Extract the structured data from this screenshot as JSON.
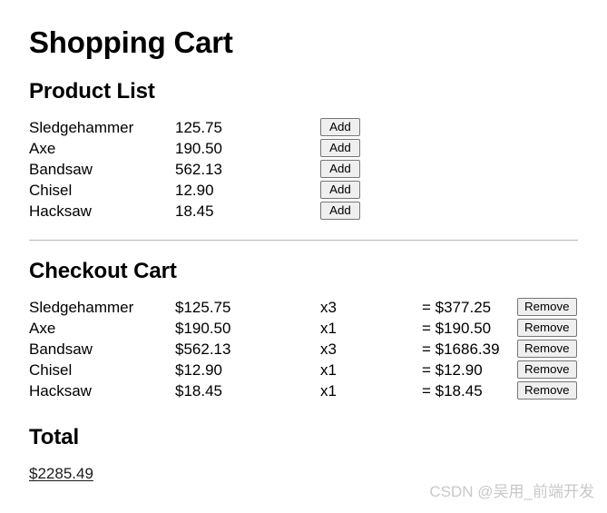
{
  "page": {
    "title": "Shopping Cart"
  },
  "product_list": {
    "heading": "Product List",
    "add_label": "Add",
    "items": [
      {
        "name": "Sledgehammer",
        "price": "125.75"
      },
      {
        "name": "Axe",
        "price": "190.50"
      },
      {
        "name": "Bandsaw",
        "price": "562.13"
      },
      {
        "name": "Chisel",
        "price": "12.90"
      },
      {
        "name": "Hacksaw",
        "price": "18.45"
      }
    ]
  },
  "checkout_cart": {
    "heading": "Checkout Cart",
    "remove_label": "Remove",
    "items": [
      {
        "name": "Sledgehammer",
        "price": "$125.75",
        "qty": "x3",
        "subtotal": "= $377.25"
      },
      {
        "name": "Axe",
        "price": "$190.50",
        "qty": "x1",
        "subtotal": "= $190.50"
      },
      {
        "name": "Bandsaw",
        "price": "$562.13",
        "qty": "x3",
        "subtotal": "= $1686.39"
      },
      {
        "name": "Chisel",
        "price": "$12.90",
        "qty": "x1",
        "subtotal": "= $12.90"
      },
      {
        "name": "Hacksaw",
        "price": "$18.45",
        "qty": "x1",
        "subtotal": "= $18.45"
      }
    ]
  },
  "total": {
    "heading": "Total",
    "value": "$2285.49"
  },
  "watermark": {
    "text": "CSDN @吴用_前端开发"
  },
  "colors": {
    "text": "#000000",
    "button_face": "#efefef",
    "button_border": "#767676",
    "divider": "#b9b9b9",
    "watermark": "#c8c8c8"
  }
}
